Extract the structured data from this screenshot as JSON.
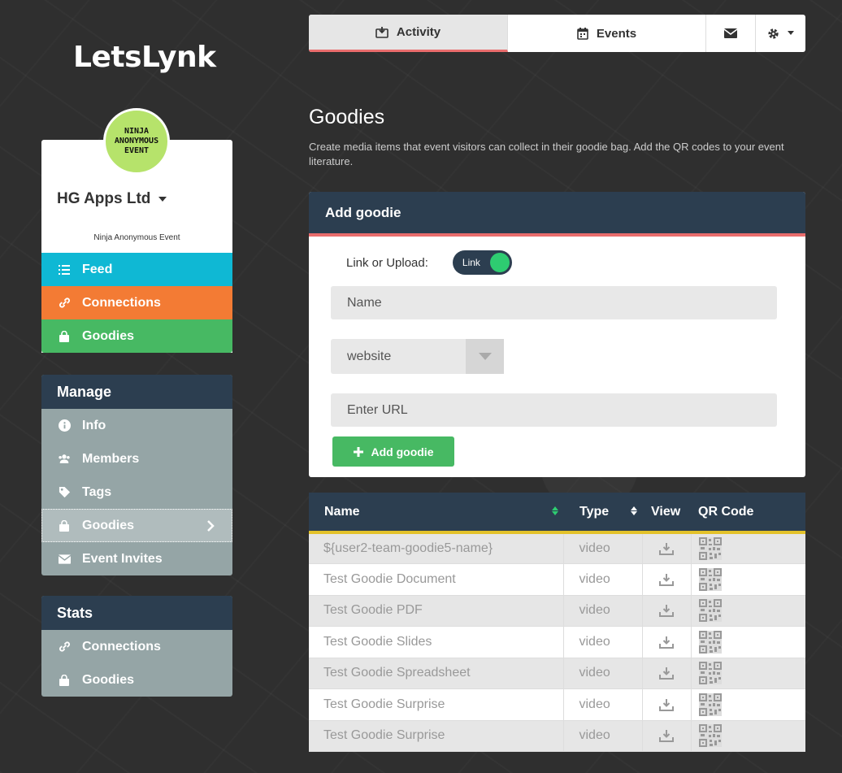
{
  "app": {
    "logo": "LetsLynk"
  },
  "profile": {
    "avatar_text": "NINJA ANONYMOUS EVENT",
    "org_name": "HG Apps Ltd",
    "event_name": "Ninja Anonymous Event"
  },
  "main_nav": [
    {
      "label": "Feed",
      "icon": "list-icon",
      "color": "#0fb8d4"
    },
    {
      "label": "Connections",
      "icon": "link-icon",
      "color": "#f37b34"
    },
    {
      "label": "Goodies",
      "icon": "bag-icon",
      "color": "#47b963"
    }
  ],
  "manage": {
    "title": "Manage",
    "items": [
      {
        "label": "Info",
        "icon": "info-icon"
      },
      {
        "label": "Members",
        "icon": "users-icon"
      },
      {
        "label": "Tags",
        "icon": "tag-icon"
      },
      {
        "label": "Goodies",
        "icon": "bag-icon",
        "active": true
      },
      {
        "label": "Event Invites",
        "icon": "envelope-icon"
      }
    ]
  },
  "stats": {
    "title": "Stats",
    "items": [
      {
        "label": "Connections",
        "icon": "link-icon"
      },
      {
        "label": "Goodies",
        "icon": "bag-icon"
      }
    ]
  },
  "topbar": {
    "activity": "Activity",
    "events": "Events"
  },
  "page": {
    "title": "Goodies",
    "description": "Create media items that event visitors can collect in their goodie bag. Add the QR codes to your event literature."
  },
  "add_goodie": {
    "title": "Add goodie",
    "toggle_label": "Link or Upload:",
    "toggle_value": "Link",
    "name_placeholder": "Name",
    "type_value": "website",
    "url_placeholder": "Enter URL",
    "button_label": "Add goodie"
  },
  "table": {
    "headers": {
      "name": "Name",
      "type": "Type",
      "view": "View",
      "qr": "QR Code"
    },
    "rows": [
      {
        "name": "${user2-team-goodie5-name}",
        "type": "video"
      },
      {
        "name": "Test Goodie Document",
        "type": "video"
      },
      {
        "name": "Test Goodie PDF",
        "type": "video"
      },
      {
        "name": "Test Goodie Slides",
        "type": "video"
      },
      {
        "name": "Test Goodie Spreadsheet",
        "type": "video"
      },
      {
        "name": "Test Goodie Surprise",
        "type": "video"
      },
      {
        "name": "Test Goodie Surprise",
        "type": "video"
      }
    ]
  },
  "colors": {
    "navy": "#2c3e50",
    "accent_red": "#e96c6c",
    "green": "#47b963",
    "cyan": "#0fb8d4",
    "orange": "#f37b34",
    "gold": "#e3c22a"
  }
}
